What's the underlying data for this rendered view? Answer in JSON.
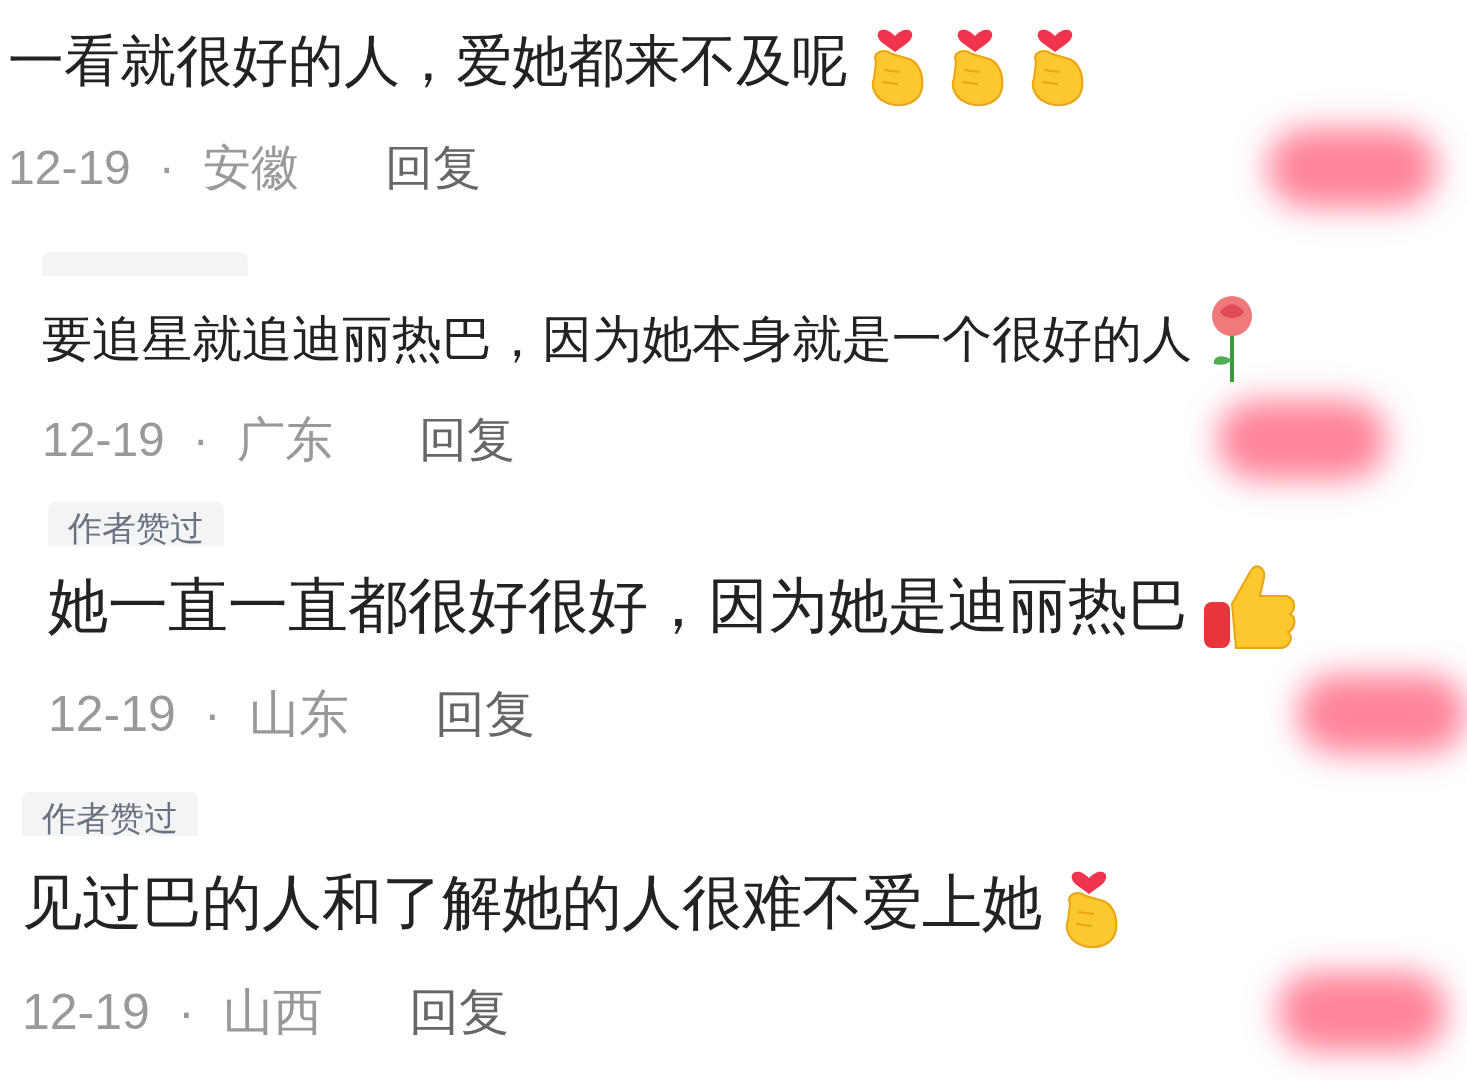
{
  "comments": [
    {
      "text": "一看就很好的人，爱她都来不及呢",
      "emojis": [
        {
          "kind": "finger-heart"
        },
        {
          "kind": "finger-heart"
        },
        {
          "kind": "finger-heart"
        }
      ],
      "date": "12-19",
      "dot": "·",
      "region": "安徽",
      "reply": "回复"
    },
    {
      "badge": {
        "kind": "fragment"
      },
      "text": "要追星就追迪丽热巴，因为她本身就是一个很好的人",
      "emojis": [
        {
          "kind": "rose"
        }
      ],
      "date": "12-19",
      "dot": "·",
      "region": "广东",
      "reply": "回复"
    },
    {
      "badge": {
        "kind": "full",
        "text": "作者赞过"
      },
      "text": "她一直一直都很好很好，因为她是迪丽热巴",
      "emojis": [
        {
          "kind": "thumbs-up"
        }
      ],
      "date": "12-19",
      "dot": "·",
      "region": "山东",
      "reply": "回复"
    },
    {
      "badge": {
        "kind": "full",
        "text": "作者赞过"
      },
      "text": "见过巴的人和了解她的人很难不爱上她",
      "emojis": [
        {
          "kind": "finger-heart"
        }
      ],
      "date": "12-19",
      "dot": "·",
      "region": "山西",
      "reply": "回复"
    }
  ]
}
